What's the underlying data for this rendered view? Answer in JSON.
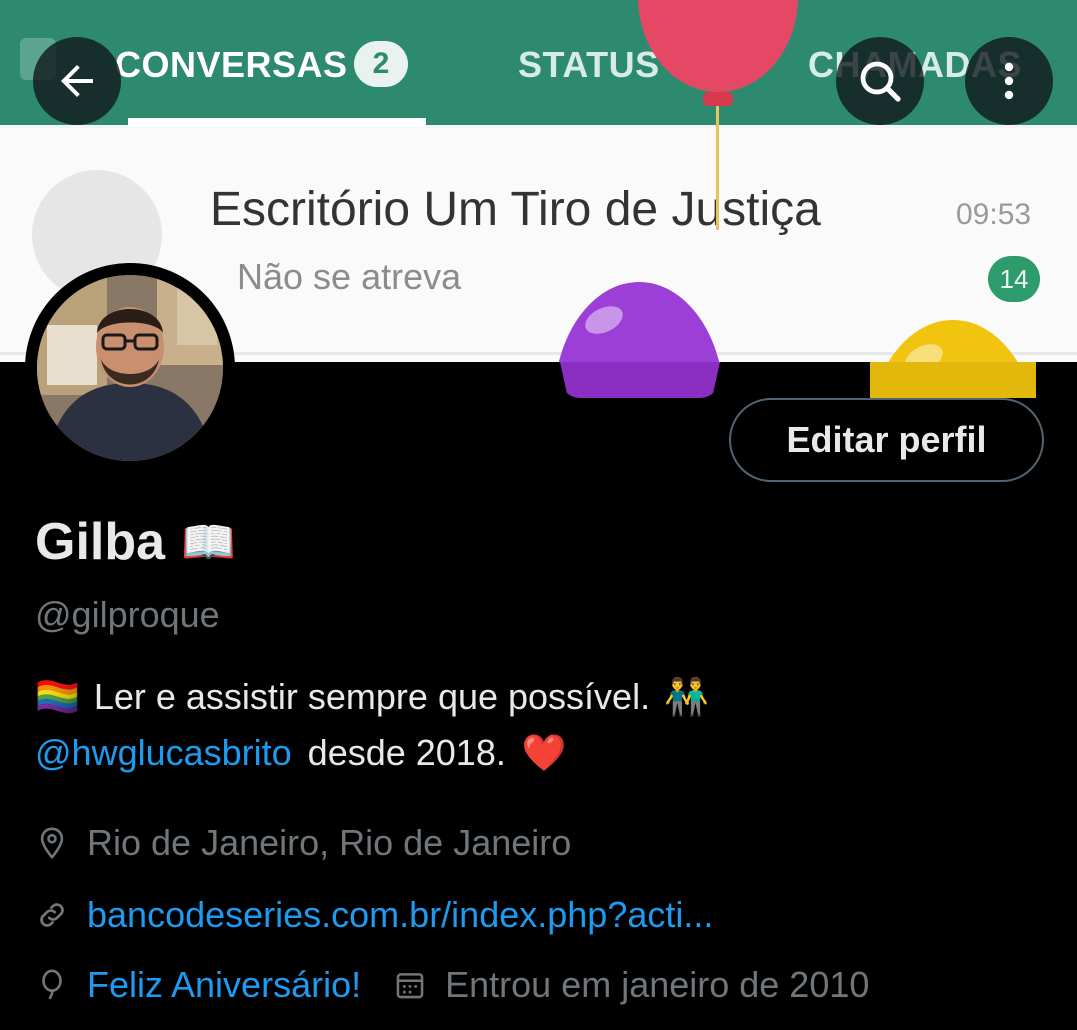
{
  "banner": {
    "tabs": [
      "CONVERSAS",
      "STATUS",
      "CHAMADAS"
    ],
    "unread_tab_count": "2",
    "chat": {
      "name": "Escritório Um Tiro de Justiça",
      "message": "Não se atreva",
      "time": "09:53",
      "unread": "14"
    }
  },
  "topbar": {
    "back_icon": "arrow-left-icon",
    "search_icon": "search-icon",
    "more_icon": "more-vertical-icon"
  },
  "profile": {
    "edit_button": "Editar perfil",
    "display_name": "Gilba",
    "name_emoji": "📖",
    "handle": "@gilproque",
    "bio_line1_emoji": "🏳️‍🌈",
    "bio_line1_text": "Ler e assistir sempre que possível.",
    "bio_line1_emoji_end": "👬",
    "bio_mention": "@hwglucasbrito",
    "bio_line2_text": "desde 2018.",
    "bio_line2_emoji": "❤️",
    "location": "Rio de Janeiro, Rio de Janeiro",
    "website": "bancodeseries.com.br/index.php?acti...",
    "birthday": "Feliz Aniversário!",
    "joined": "Entrou em janeiro de 2010"
  },
  "colors": {
    "background": "#000000",
    "accent": "#1d9bf0",
    "muted": "#71767b",
    "text": "#e7e9ea"
  }
}
